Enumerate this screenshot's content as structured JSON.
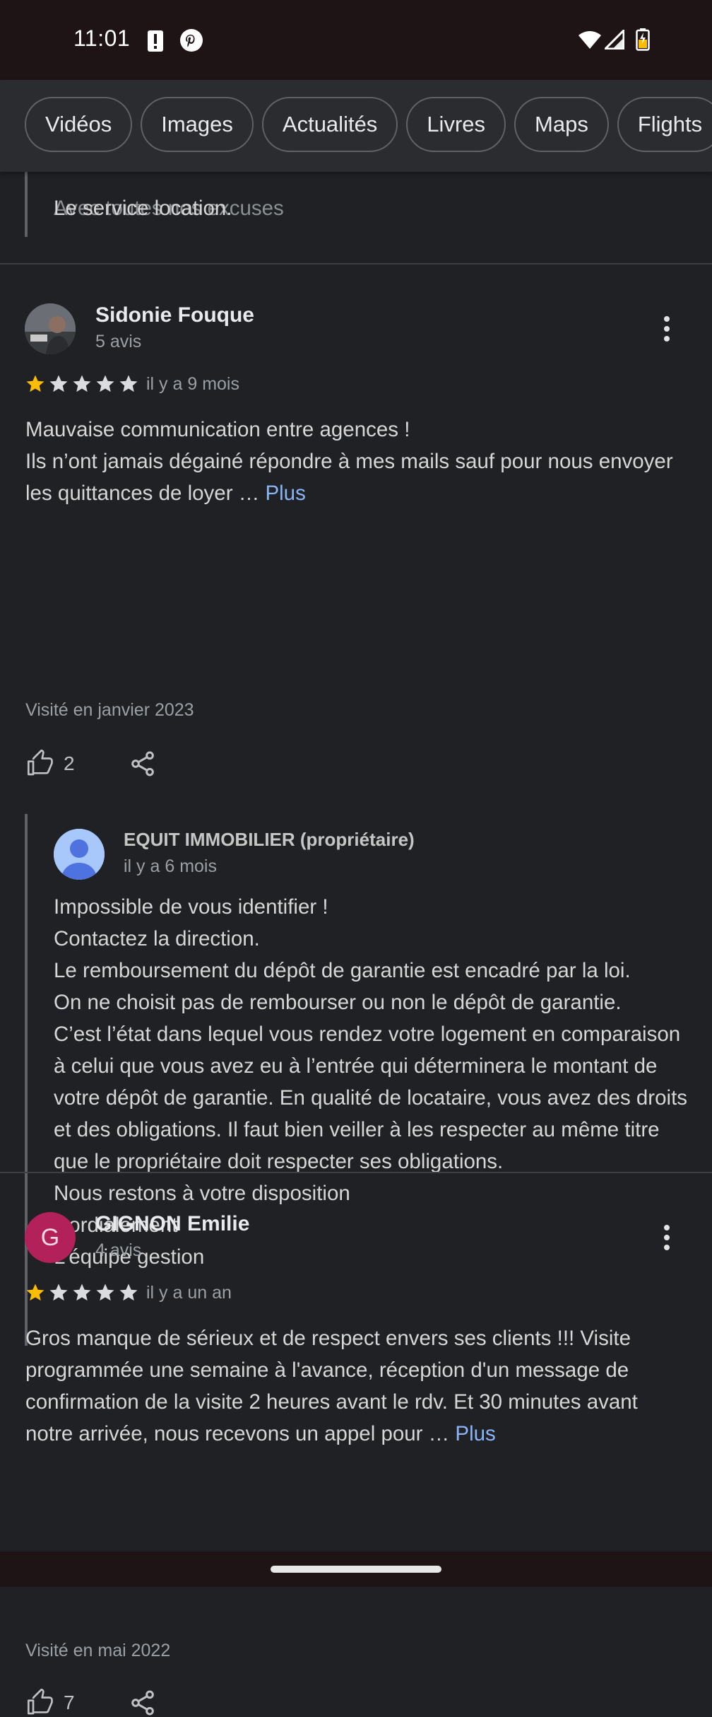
{
  "status_bar": {
    "time": "11:01"
  },
  "chips": [
    "Vidéos",
    "Images",
    "Actualités",
    "Livres",
    "Maps",
    "Flights"
  ],
  "previous_reply": {
    "lines": [
      "Avec toutes nos excuses",
      "Le service location."
    ]
  },
  "reviews": [
    {
      "author": "Sidonie Fouque",
      "reviews_count": "5 avis",
      "rating": 1,
      "time": "il y a 9 mois",
      "text": "Mauvaise communication entre agences !\nIls n’ont jamais dégainé répondre à mes mails sauf pour nous envoyer les quittances de loyer … ",
      "more_label": "Plus",
      "visited": "Visité en janvier 2023",
      "likes": "2",
      "reply": {
        "author": "EQUIT IMMOBILIER (propriétaire)",
        "time": "il y a 6 mois",
        "text": "Impossible de vous identifier !\nContactez la direction.\nLe remboursement du dépôt de garantie est encadré par la loi.\nOn ne choisit pas de rembourser ou non le dépôt de garantie.\nC’est l’état dans lequel vous rendez votre logement en comparaison à celui que vous avez eu à l’entrée qui déterminera le montant de votre dépôt de garantie. En qualité de locataire, vous avez des droits et des obligations. Il faut bien veiller à les respecter au même titre que le propriétaire doit respecter ses obligations.\nNous restons à votre disposition\nCordialement\nL’équipe gestion"
      }
    },
    {
      "author": "GIGNON Emilie",
      "avatar_letter": "G",
      "avatar_color": "#b3215a",
      "reviews_count": "4 avis",
      "rating": 1,
      "time": "il y a un an",
      "text": "Gros manque de sérieux et de respect envers ses clients !!! Visite programmée une semaine à l'avance, réception d'un message de confirmation de la visite 2 heures avant le rdv. Et 30 minutes avant notre arrivée, nous recevons un appel pour … ",
      "more_label": "Plus",
      "visited": "Visité en mai 2022",
      "likes": "7"
    }
  ],
  "colors": {
    "star_filled": "#fbbc04",
    "star_empty": "#dadce0",
    "link": "#8ab4f8",
    "background": "#202124"
  }
}
